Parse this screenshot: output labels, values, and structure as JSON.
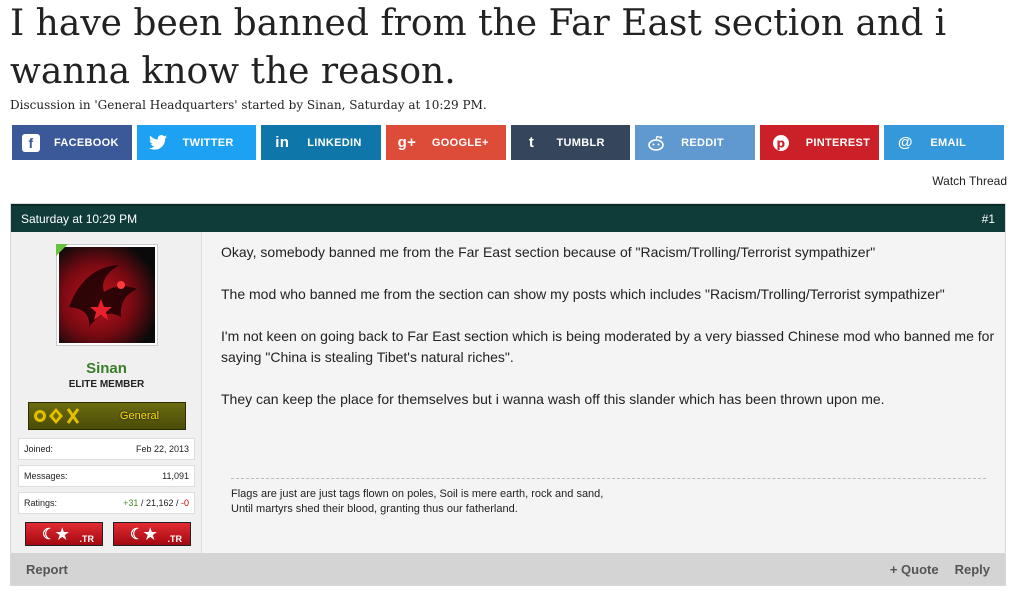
{
  "thread": {
    "title": "I have been banned from the Far East section and i wanna know the reason.",
    "meta": "Discussion in 'General Headquarters' started by Sinan, Saturday at 10:29 PM."
  },
  "share": {
    "facebook": "FACEBOOK",
    "twitter": "TWITTER",
    "linkedin": "LINKEDIN",
    "google": "GOOGLE+",
    "tumblr": "TUMBLR",
    "reddit": "REDDIT",
    "pinterest": "PINTEREST",
    "email": "EMAIL"
  },
  "watch_label": "Watch Thread",
  "post": {
    "date": "Saturday at 10:29 PM",
    "number": "#1",
    "paragraphs": [
      "Okay, somebody banned me from the Far East section because of \"Racism/Trolling/Terrorist sympathizer\"",
      "The mod who banned me from the section can show my posts which includes \"Racism/Trolling/Terrorist sympathizer\"",
      "I'm not keen on going back to Far East section which is being moderated by a very biassed Chinese mod who banned me for saying \"China is stealing Tibet's natural riches\".",
      "They can keep the place for themselves but i wanna wash off this slander which has been thrown upon me."
    ],
    "signature": [
      "Flags are just are just tags flown on poles, Soil is mere earth, rock and sand,",
      "Until martyrs shed their blood, granting thus our fatherland."
    ],
    "report": "Report",
    "quote": "+ Quote",
    "reply": "Reply"
  },
  "user": {
    "name": "Sinan",
    "title": "ELITE MEMBER",
    "rank": "General",
    "joined_label": "Joined:",
    "joined": "Feb 22, 2013",
    "messages_label": "Messages:",
    "messages": "11,091",
    "ratings_label": "Ratings:",
    "ratings_pos": "+31",
    "ratings_sep1": " / ",
    "ratings_neutral": "21,162",
    "ratings_sep2": " / ",
    "ratings_neg": "-0",
    "flag_label": ".TR"
  },
  "colors": {
    "header": "#0f3b39",
    "username": "#3a7d2a"
  }
}
